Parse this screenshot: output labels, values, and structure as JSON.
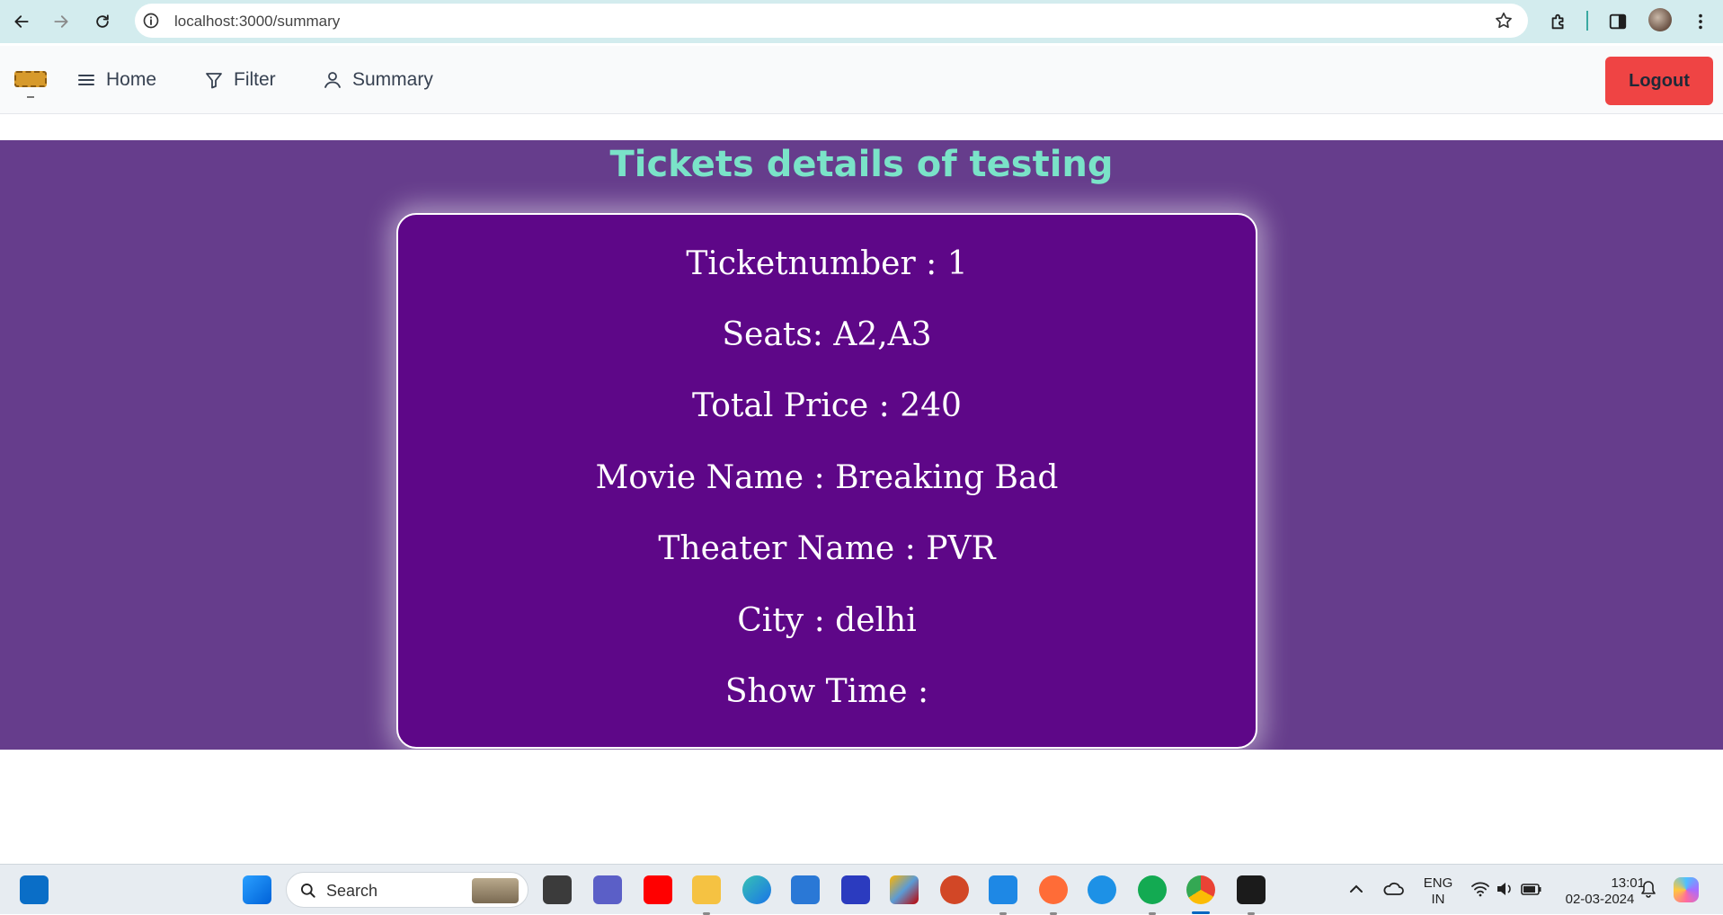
{
  "browser": {
    "url": "localhost:3000/summary"
  },
  "navbar": {
    "items": [
      {
        "label": "Home",
        "icon": "menu-icon"
      },
      {
        "label": "Filter",
        "icon": "filter-icon"
      },
      {
        "label": "Summary",
        "icon": "user-icon"
      }
    ],
    "logout_label": "Logout"
  },
  "page": {
    "title": "Tickets details of testing"
  },
  "ticket": {
    "number_line": "Ticketnumber : 1",
    "seats_line": "Seats: A2,A3",
    "price_line": "Total Price : 240",
    "movie_line": "Movie Name : Breaking Bad",
    "theater_line": "Theater Name : PVR",
    "city_line": "City : delhi",
    "showtime_line": "Show Time :"
  },
  "taskbar": {
    "search_placeholder": "Search",
    "language_top": "ENG",
    "language_bottom": "IN",
    "time": "13:01",
    "date": "02-03-2024"
  },
  "colors": {
    "band": "#663d8c",
    "card": "#5e0788",
    "title": "#7ae3c8",
    "logout": "#ef4444"
  }
}
